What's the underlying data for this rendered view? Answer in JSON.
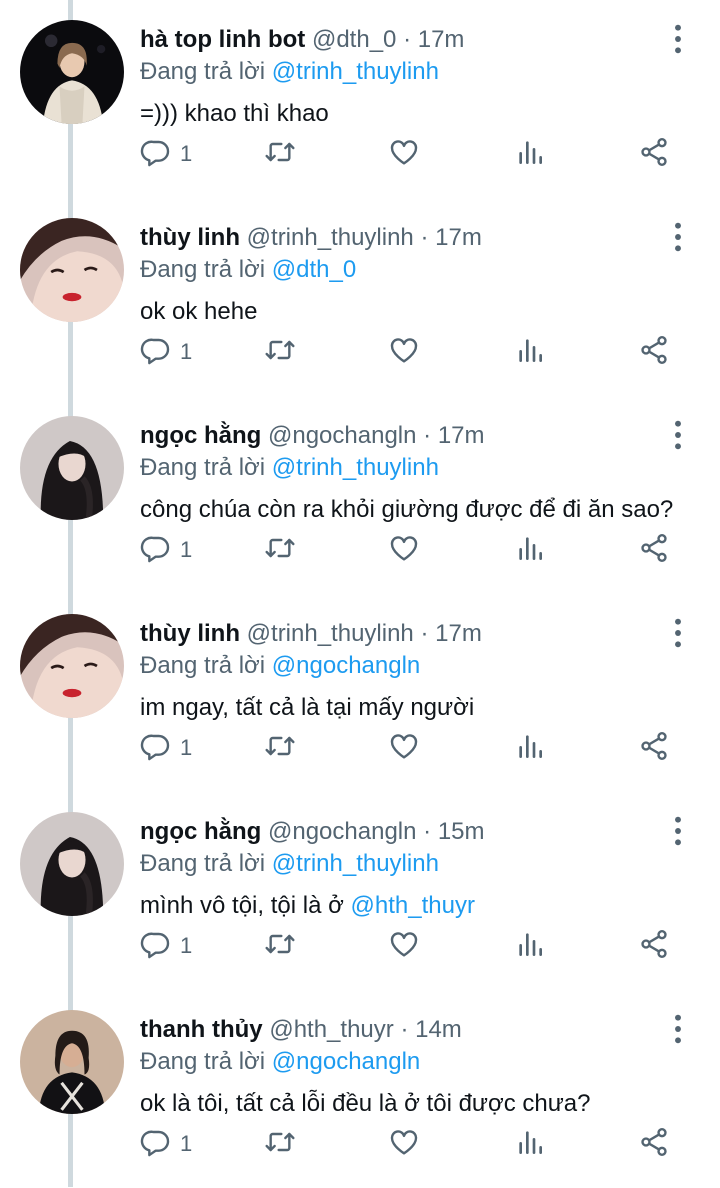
{
  "tweets": [
    {
      "name": "hà top linh bot",
      "handle": "@dth_0",
      "dot": "·",
      "time": "17m",
      "reply_prefix": "Đang trả lời",
      "reply_to": "@trinh_thuylinh",
      "text": "=))) khao thì khao",
      "text_mention": "",
      "reply_count": "1",
      "avatar": "girl-white-jacket"
    },
    {
      "name": "thùy linh",
      "handle": "@trinh_thuylinh",
      "dot": "·",
      "time": "17m",
      "reply_prefix": "Đang trả lời",
      "reply_to": "@dth_0",
      "text": "ok ok hehe",
      "text_mention": "",
      "reply_count": "1",
      "avatar": "girl-red-lips"
    },
    {
      "name": "ngọc hằng",
      "handle": "@ngochangln",
      "dot": "·",
      "time": "17m",
      "reply_prefix": "Đang trả lời",
      "reply_to": "@trinh_thuylinh",
      "text": "công chúa còn ra khỏi giường được để đi ăn sao?",
      "text_mention": "",
      "reply_count": "1",
      "avatar": "girl-long-hair"
    },
    {
      "name": "thùy linh",
      "handle": "@trinh_thuylinh",
      "dot": "·",
      "time": "17m",
      "reply_prefix": "Đang trả lời",
      "reply_to": "@ngochangln",
      "text": "im ngay, tất cả là tại mấy người",
      "text_mention": "",
      "reply_count": "1",
      "avatar": "girl-red-lips"
    },
    {
      "name": "ngọc hằng",
      "handle": "@ngochangln",
      "dot": "·",
      "time": "15m",
      "reply_prefix": "Đang trả lời",
      "reply_to": "@trinh_thuylinh",
      "text": "mình vô tội, tội là ở ",
      "text_mention": "@hth_thuyr",
      "reply_count": "1",
      "avatar": "girl-long-hair"
    },
    {
      "name": "thanh thủy",
      "handle": "@hth_thuyr",
      "dot": "·",
      "time": "14m",
      "reply_prefix": "Đang trả lời",
      "reply_to": "@ngochangln",
      "text": "ok là tôi, tất cả lỗi đều là ở tôi được chưa?",
      "text_mention": "",
      "reply_count": "1",
      "avatar": "girl-black-tshirt"
    }
  ],
  "colors": {
    "text": "#0f1419",
    "secondary": "#536471",
    "mention": "#1d9bf0",
    "thread_line": "#cfd9de"
  },
  "icons": [
    "reply-icon",
    "retweet-icon",
    "like-icon",
    "views-icon",
    "share-icon",
    "more-icon"
  ]
}
